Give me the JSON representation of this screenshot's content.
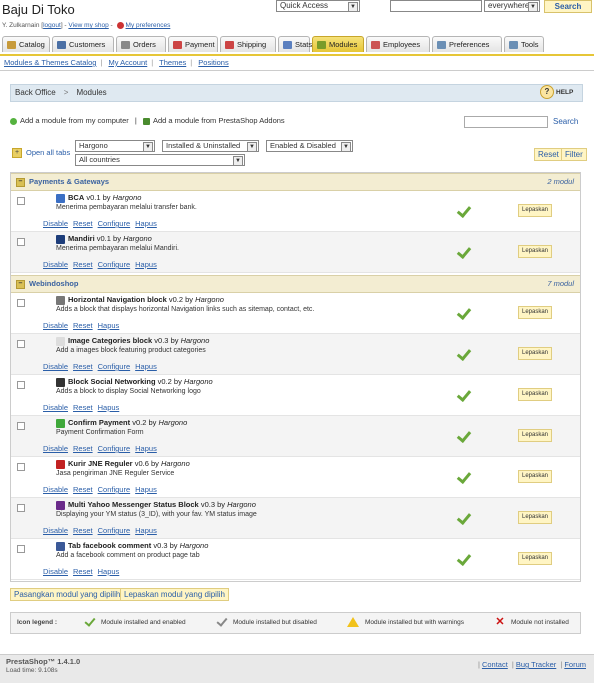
{
  "header": {
    "shop_name": "Baju Di Toko",
    "user_name": "Y. Zulkarnain",
    "logout": "logout",
    "view_shop": "View my shop",
    "preferences": "My preferences",
    "quick_access": "Quick Access",
    "search_scope": "everywhere",
    "search_button": "Search"
  },
  "tabs": [
    {
      "label": "Catalog",
      "color": "#c79a3a"
    },
    {
      "label": "Customers",
      "color": "#4a6fa5"
    },
    {
      "label": "Orders",
      "color": "#888888"
    },
    {
      "label": "Payment",
      "color": "#c44"
    },
    {
      "label": "Shipping",
      "color": "#c44"
    },
    {
      "label": "Stats",
      "color": "#5a7fbf"
    },
    {
      "label": "Modules",
      "color": "#7a9c2a",
      "active": true
    },
    {
      "label": "Employees",
      "color": "#c55"
    },
    {
      "label": "Preferences",
      "color": "#6b8fb5"
    },
    {
      "label": "Tools",
      "color": "#6b8fb5"
    }
  ],
  "subnav": [
    "Modules & Themes Catalog",
    "My Account",
    "Themes",
    "Positions"
  ],
  "breadcrumb": {
    "root": "Back Office",
    "current": "Modules",
    "help": "HELP"
  },
  "add_links": {
    "computer": "Add a module from my computer",
    "addons": "Add a module from PrestaShop Addons",
    "search_button": "Search"
  },
  "filters": {
    "open_all": "Open all tabs",
    "author": "Hargono",
    "install_state": "Installed & Uninstalled",
    "enable_state": "Enabled & Disabled",
    "country": "All countries",
    "reset": "Reset",
    "filter": "Filter"
  },
  "categories": [
    {
      "name": "Payments & Gateways",
      "count": "2 modul",
      "modules": [
        {
          "name": "BCA",
          "version": "v0.1",
          "by": "by",
          "author": "Hargono",
          "desc": "Menerima pembayaran melalui transfer bank.",
          "actions": [
            "Disable",
            "Reset",
            "Configure",
            "Hapus"
          ],
          "icon": "#3b6fc4"
        },
        {
          "name": "Mandiri",
          "version": "v0.1",
          "by": "by",
          "author": "Hargono",
          "desc": "Menerima pembayaran melalui Mandiri.",
          "actions": [
            "Disable",
            "Reset",
            "Configure",
            "Hapus"
          ],
          "icon": "#1d3d7a"
        }
      ]
    },
    {
      "name": "Webindoshop",
      "count": "7 modul",
      "modules": [
        {
          "name": "Horizontal Navigation block",
          "version": "v0.2",
          "by": "by",
          "author": "Hargono",
          "desc": "Adds a block that displays horizontal Navigation links such as sitemap, contact, etc.",
          "actions": [
            "Disable",
            "Reset",
            "Hapus"
          ],
          "icon": "#777777"
        },
        {
          "name": "Image Categories block",
          "version": "v0.3",
          "by": "by",
          "author": "Hargono",
          "desc": "Add a images block featuring product categories",
          "actions": [
            "Disable",
            "Reset",
            "Configure",
            "Hapus"
          ],
          "icon": "#dddddd"
        },
        {
          "name": "Block Social Networking",
          "version": "v0.2",
          "by": "by",
          "author": "Hargono",
          "desc": "Adds a block to display Social Networking logo",
          "actions": [
            "Disable",
            "Reset",
            "Hapus"
          ],
          "icon": "#333333"
        },
        {
          "name": "Confirm Payment",
          "version": "v0.2",
          "by": "by",
          "author": "Hargono",
          "desc": "Payment Confirmation Form",
          "actions": [
            "Disable",
            "Reset",
            "Configure",
            "Hapus"
          ],
          "icon": "#3fa83a"
        },
        {
          "name": "Kurir JNE Reguler",
          "version": "v0.6",
          "by": "by",
          "author": "Hargono",
          "desc": "Jasa pengiriman JNE Reguler Service",
          "actions": [
            "Disable",
            "Reset",
            "Configure",
            "Hapus"
          ],
          "icon": "#c22222"
        },
        {
          "name": "Multi Yahoo Messenger Status Block",
          "version": "v0.3",
          "by": "by",
          "author": "Hargono",
          "desc": "Displaying your YM status (3_ID), with your fav. YM status image",
          "actions": [
            "Disable",
            "Reset",
            "Configure",
            "Hapus"
          ],
          "icon": "#6a2a8a"
        },
        {
          "name": "Tab facebook comment",
          "version": "v0.3",
          "by": "by",
          "author": "Hargono",
          "desc": "Add a facebook comment on product page tab",
          "actions": [
            "Disable",
            "Reset",
            "Hapus"
          ],
          "icon": "#3b5998"
        }
      ]
    }
  ],
  "uninstall_label": "Lepaskan",
  "bulk": {
    "install": "Pasangkan modul yang dipilih",
    "uninstall": "Lepaskan modul yang dipilih"
  },
  "legend": {
    "title": "Icon legend :",
    "items": [
      "Module installed and enabled",
      "Module installed but disabled",
      "Module installed but with warnings",
      "Module not installed"
    ]
  },
  "footer": {
    "version": "PrestaShop™ 1.4.1.0",
    "load_time": "Load time: 9.108s",
    "links": [
      "Contact",
      "Bug Tracker",
      "Forum"
    ]
  }
}
